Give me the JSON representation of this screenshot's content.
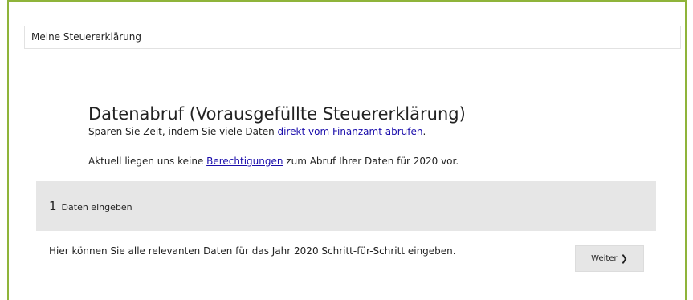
{
  "breadcrumb": {
    "label": "Meine Steuererklärung"
  },
  "main": {
    "title": "Datenabruf (Vorausgefüllte Steuererklärung)",
    "line1_pre": "Sparen Sie Zeit, indem Sie viele Daten ",
    "line1_link": "direkt vom Finanzamt abrufen",
    "line1_post": ".",
    "line2_pre": "Aktuell liegen uns keine ",
    "line2_link": "Berechtigungen",
    "line2_post": " zum Abruf Ihrer Daten für 2020 vor."
  },
  "step": {
    "number": "1",
    "label": "Daten eingeben"
  },
  "description": "Hier können Sie alle relevanten Daten für das Jahr 2020 Schritt-für-Schritt eingeben.",
  "next_button": {
    "label": "Weiter",
    "icon": "chevron-right-icon"
  }
}
